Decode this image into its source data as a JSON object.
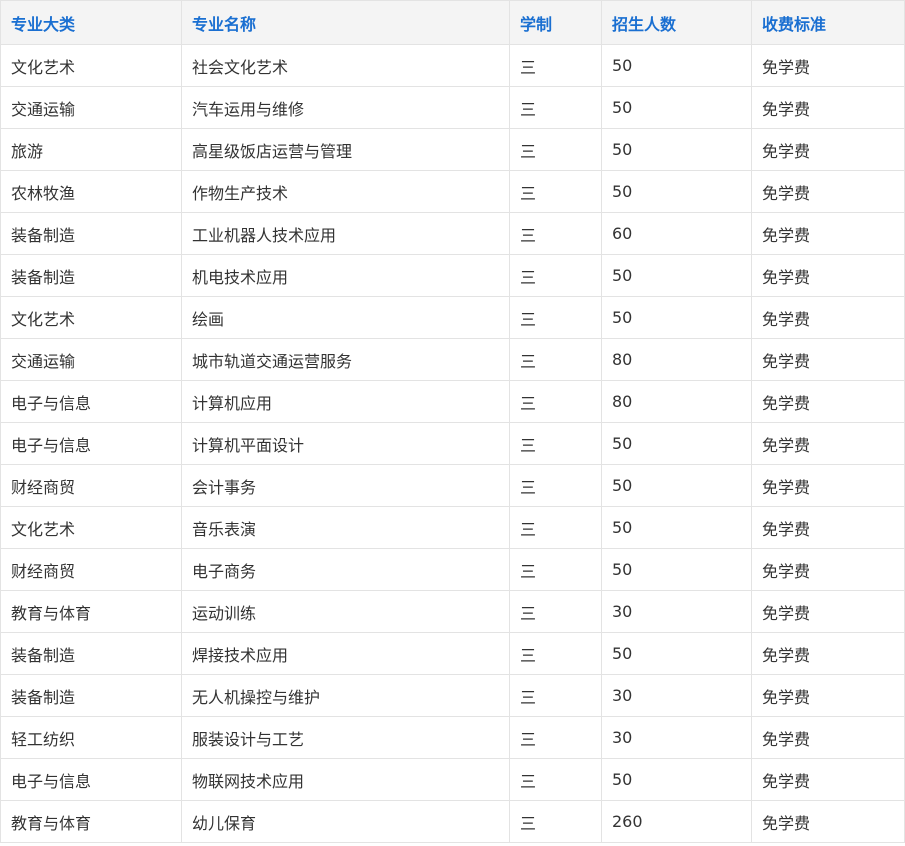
{
  "table": {
    "headers": [
      "专业大类",
      "专业名称",
      "学制",
      "招生人数",
      "收费标准"
    ],
    "rows": [
      [
        "文化艺术",
        "社会文化艺术",
        "三",
        "50",
        "免学费"
      ],
      [
        "交通运输",
        "汽车运用与维修",
        "三",
        "50",
        "免学费"
      ],
      [
        "旅游",
        "高星级饭店运营与管理",
        "三",
        "50",
        "免学费"
      ],
      [
        "农林牧渔",
        "作物生产技术",
        "三",
        "50",
        "免学费"
      ],
      [
        "装备制造",
        "工业机器人技术应用",
        "三",
        "60",
        "免学费"
      ],
      [
        "装备制造",
        "机电技术应用",
        "三",
        "50",
        "免学费"
      ],
      [
        "文化艺术",
        "绘画",
        "三",
        "50",
        "免学费"
      ],
      [
        "交通运输",
        "城市轨道交通运营服务",
        "三",
        "80",
        "免学费"
      ],
      [
        "电子与信息",
        "计算机应用",
        "三",
        "80",
        "免学费"
      ],
      [
        "电子与信息",
        "计算机平面设计",
        "三",
        "50",
        "免学费"
      ],
      [
        "财经商贸",
        "会计事务",
        "三",
        "50",
        "免学费"
      ],
      [
        "文化艺术",
        "音乐表演",
        "三",
        "50",
        "免学费"
      ],
      [
        "财经商贸",
        "电子商务",
        "三",
        "50",
        "免学费"
      ],
      [
        "教育与体育",
        "运动训练",
        "三",
        "30",
        "免学费"
      ],
      [
        "装备制造",
        "焊接技术应用",
        "三",
        "50",
        "免学费"
      ],
      [
        "装备制造",
        "无人机操控与维护",
        "三",
        "30",
        "免学费"
      ],
      [
        "轻工纺织",
        "服装设计与工艺",
        "三",
        "30",
        "免学费"
      ],
      [
        "电子与信息",
        "物联网技术应用",
        "三",
        "50",
        "免学费"
      ],
      [
        "教育与体育",
        "幼儿保育",
        "三",
        "260",
        "免学费"
      ]
    ]
  },
  "colors": {
    "header_text": "#1a6fd1",
    "header_bg": "#f4f4f4",
    "cell_text": "#333333",
    "border": "#e3e3e3"
  }
}
